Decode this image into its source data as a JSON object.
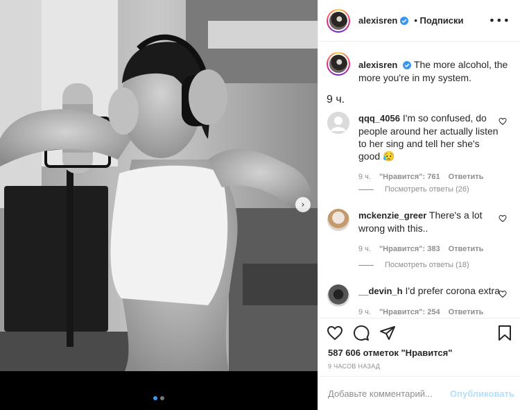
{
  "post": {
    "username": "alexisren",
    "follow_label": "• Подписки",
    "caption_text": "The more alcohol, the more you're in my system.",
    "caption_time": "9 ч.",
    "more_icon": "more-horizontal-icon"
  },
  "comments": [
    {
      "username": "qqq_4056",
      "text": "I'm so confused, do people around her actually listen to her sing and tell her she's good 😥",
      "time": "9 ч.",
      "likes": "\"Нравится\": 761",
      "reply": "Ответить",
      "view_replies": "Посмотреть ответы (26)"
    },
    {
      "username": "mckenzie_greer",
      "text": "There's a lot wrong with this..",
      "time": "9 ч.",
      "likes": "\"Нравится\": 383",
      "reply": "Ответить",
      "view_replies": "Посмотреть ответы (18)"
    },
    {
      "username": "__devin_h",
      "text": "I'd prefer corona extra",
      "time": "9 ч.",
      "likes": "\"Нравится\": 254",
      "reply": "Ответить"
    }
  ],
  "footer": {
    "likes_count": "587 606 отметок \"Нравится\"",
    "posted_ago": "9 часов назад",
    "comment_placeholder": "Добавьте комментарий...",
    "post_label": "Опубликовать"
  },
  "carousel": {
    "current": 1,
    "total": 2
  },
  "colors": {
    "accent": "#3897f0",
    "post_button": "#b2dffc",
    "muted": "#8e8e8e"
  }
}
